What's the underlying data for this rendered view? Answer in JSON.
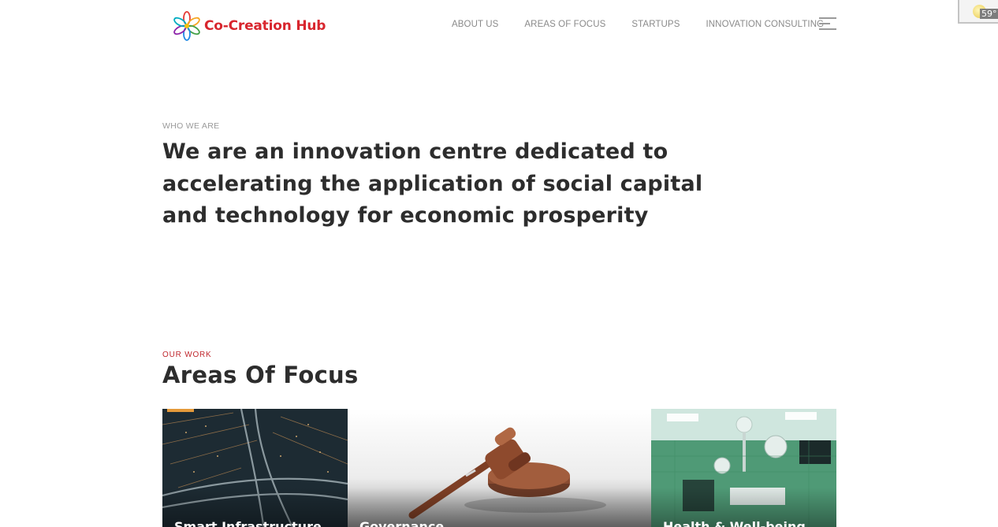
{
  "header": {
    "logo_text": "Co-Creation Hub",
    "logo_icon": "flower-logo-icon",
    "nav": [
      {
        "label": "ABOUT US"
      },
      {
        "label": "AREAS OF FOCUS"
      },
      {
        "label": "STARTUPS"
      },
      {
        "label": "INNOVATION CONSULTING"
      }
    ],
    "menu_icon": "hamburger-menu-icon"
  },
  "weather_widget": {
    "icon": "sun-icon",
    "temperature": "59°"
  },
  "who_we_are": {
    "eyebrow": "WHO WE ARE",
    "headline_lines": [
      "We are an innovation centre dedicated to",
      "accelerating the application of social capital",
      "and technology for economic prosperity"
    ]
  },
  "our_work": {
    "eyebrow": "OUR WORK",
    "title": "Areas Of Focus",
    "cards": [
      {
        "label": "Smart Infrastructure",
        "image": "highway-interchange-night-image"
      },
      {
        "label": "Governance",
        "image": "gavel-image"
      },
      {
        "label": "Health & Well-being",
        "image": "operating-room-image"
      }
    ]
  },
  "colors": {
    "brand_red": "#d8262e",
    "eyebrow_red": "#c0282e",
    "nav_grey": "#8a8a8a",
    "heading": "#2d2d2d"
  }
}
